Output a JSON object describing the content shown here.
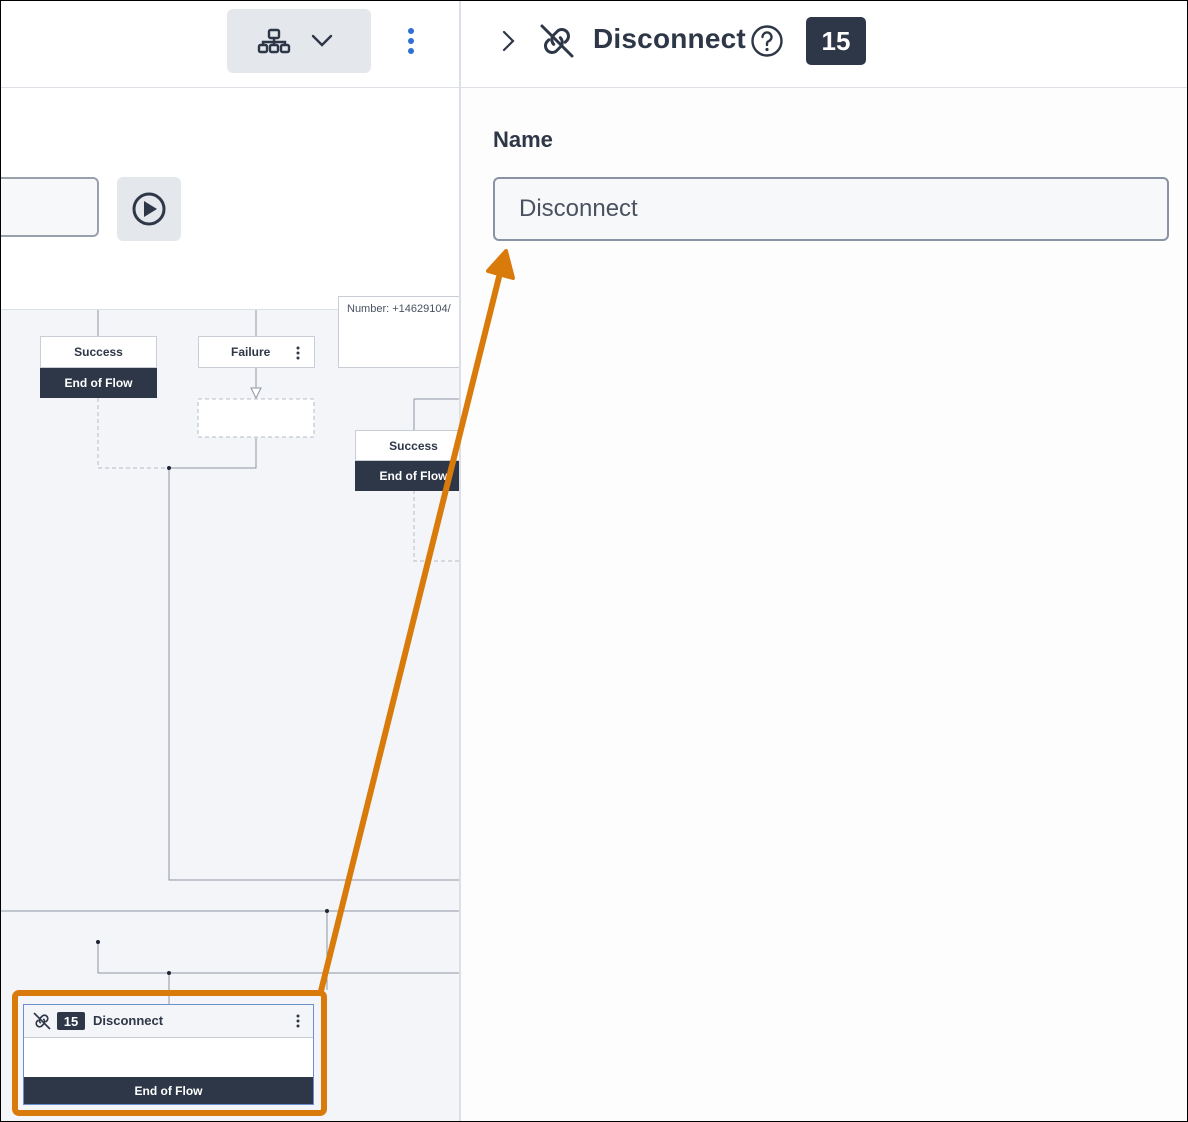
{
  "toolbar": {
    "hierarchy_icon": "sitemap-icon",
    "dropdown_icon": "chevron-down-icon",
    "more_icon": "more-vertical-icon",
    "play_icon": "play-circle-icon"
  },
  "canvas": {
    "node1": {
      "path_label": "Success",
      "action_label": "End of Flow"
    },
    "node2": {
      "path_label": "Failure"
    },
    "node3": {
      "partial_text": "Number: +14629104/"
    },
    "node4": {
      "path_label": "Success",
      "action_label": "End of Flow"
    },
    "disconnect_node": {
      "step_number": "15",
      "title": "Disconnect",
      "action_label": "End of Flow",
      "icon": "unlink-icon"
    }
  },
  "panel": {
    "collapse_icon": "chevron-right-icon",
    "type_icon": "unlink-icon",
    "title": "Disconnect",
    "help_icon": "help-circle-icon",
    "step_number": "15",
    "name_label": "Name",
    "name_value": "Disconnect"
  },
  "colors": {
    "accent_blue": "#2f6fd6",
    "dark_navy": "#2e3747",
    "highlight_orange": "#d97b0a",
    "canvas_bg": "#f4f5f9"
  }
}
